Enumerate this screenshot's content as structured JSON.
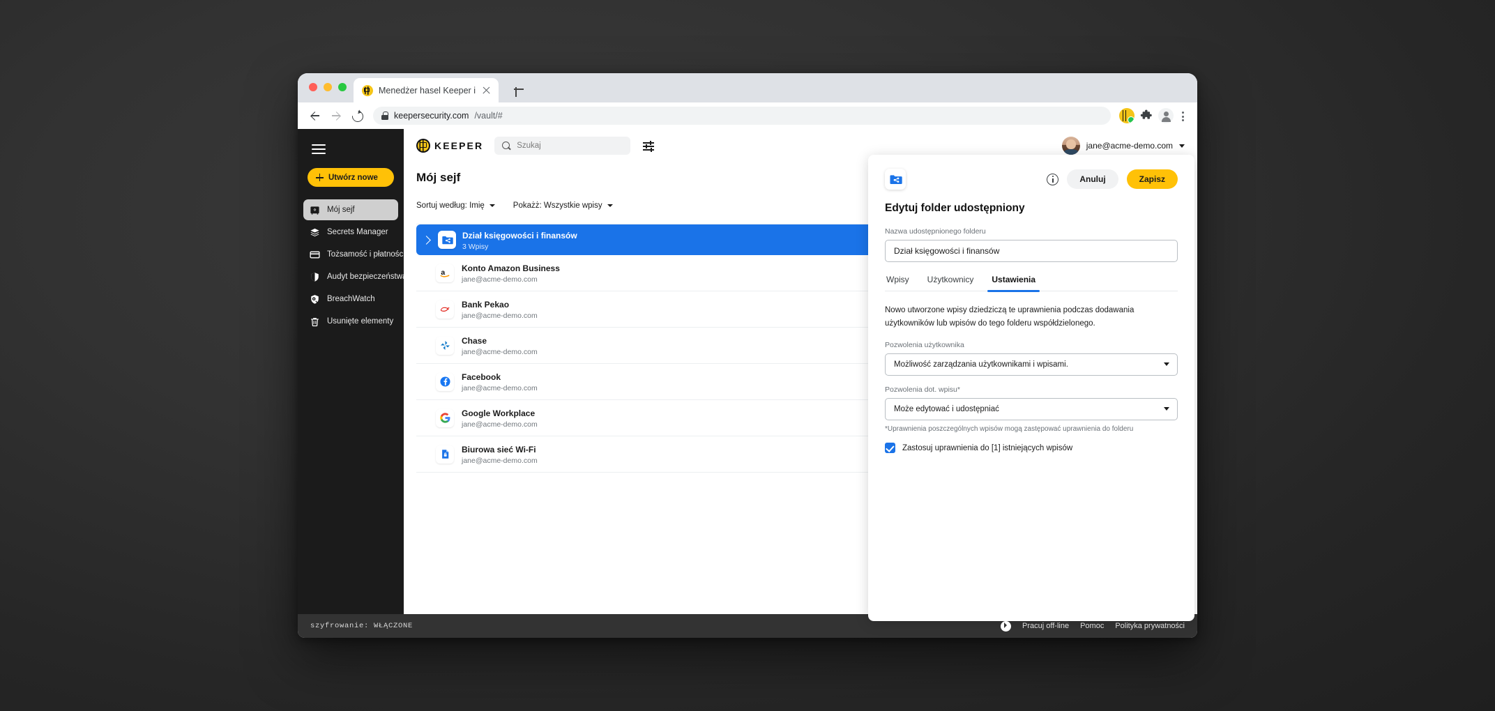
{
  "browser": {
    "tab_title": "Menedżer hasel Keeper i",
    "url_host": "keepersecurity.com",
    "url_path": "/vault/#",
    "new_tab_label": "+"
  },
  "sidebar": {
    "create_button": "Utwórz nowe",
    "items": [
      {
        "label": "Mój sejf",
        "icon": "vault-icon",
        "active": true
      },
      {
        "label": "Secrets Manager",
        "icon": "layers-icon",
        "active": false
      },
      {
        "label": "Tożsamość i płatności",
        "icon": "card-icon",
        "active": false
      },
      {
        "label": "Audyt bezpieczeństwa",
        "icon": "shield-icon",
        "active": false
      },
      {
        "label": "BreachWatch",
        "icon": "breachwatch-icon",
        "active": false
      },
      {
        "label": "Usunięte elementy",
        "icon": "trash-icon",
        "active": false
      }
    ]
  },
  "topbar": {
    "logo_text": "KEEPER",
    "search_placeholder": "Szukaj",
    "search_value": "",
    "account_email": "jane@acme-demo.com"
  },
  "vault": {
    "page_title": "Mój sejf",
    "sort_label": "Sortuj według: Imię",
    "show_label": "Pokażż: Wszystkie wpisy",
    "folder": {
      "name": "Dział księgowości i finansów",
      "count_label": "3 Wpisy"
    },
    "entries": [
      {
        "title": "Konto Amazon Business",
        "subtitle": "jane@acme-demo.com",
        "icon": "amazon-icon",
        "has_attachment": true,
        "has_star": true,
        "has_share": true
      },
      {
        "title": "Bank Pekao",
        "subtitle": "jane@acme-demo.com",
        "icon": "pekao-icon",
        "has_attachment": false,
        "has_star": true,
        "has_share": true
      },
      {
        "title": "Chase",
        "subtitle": "jane@acme-demo.com",
        "icon": "chase-icon",
        "has_attachment": true,
        "has_star": true,
        "has_share": false
      },
      {
        "title": "Facebook",
        "subtitle": "jane@acme-demo.com",
        "icon": "facebook-icon",
        "has_attachment": false,
        "has_star": true,
        "has_share": false
      },
      {
        "title": "Google Workplace",
        "subtitle": "jane@acme-demo.com",
        "icon": "google-icon",
        "has_attachment": false,
        "has_star": false,
        "has_share": false
      },
      {
        "title": "Biurowa sieć Wi-Fi",
        "subtitle": "jane@acme-demo.com",
        "icon": "file-lock-icon",
        "has_attachment": false,
        "has_star": false,
        "has_share": false
      }
    ]
  },
  "panel": {
    "cancel_label": "Anuluj",
    "save_label": "Zapisz",
    "title": "Edytuj folder udostępniony",
    "name_label": "Nazwa udostępnionego folderu",
    "name_value": "Dział księgowości i finansów",
    "tabs": [
      {
        "label": "Wpisy",
        "active": false
      },
      {
        "label": "Użytkownicy",
        "active": false
      },
      {
        "label": "Ustawienia",
        "active": true
      }
    ],
    "description": "Nowo utworzone wpisy dziedziczą te uprawnienia podczas dodawania użytkowników lub wpisów do tego folderu współdzielonego.",
    "user_perm_label": "Pozwolenia użytkownika",
    "user_perm_value": "Możliwość zarządzania użytkownikami i wpisami.",
    "record_perm_label": "Pozwolenia dot. wpisu*",
    "record_perm_value": "Może edytować i udostępniać",
    "footnote": "*Uprawnienia poszczególnych wpisów mogą zastępować uprawnienia do folderu",
    "checkbox_label": "Zastosuj uprawnienia do [1] istniejących wpisów",
    "checkbox_checked": true
  },
  "footer": {
    "encryption": "szyfrowanie: WŁĄCZONE",
    "links": [
      "Pracuj off-line",
      "Pomoc",
      "Polityka prywatności"
    ]
  },
  "colors": {
    "accent_blue": "#1a73e8",
    "brand_yellow": "#ffc107",
    "sidebar_dark": "#1b1b1b",
    "footer_dark": "#333333"
  }
}
